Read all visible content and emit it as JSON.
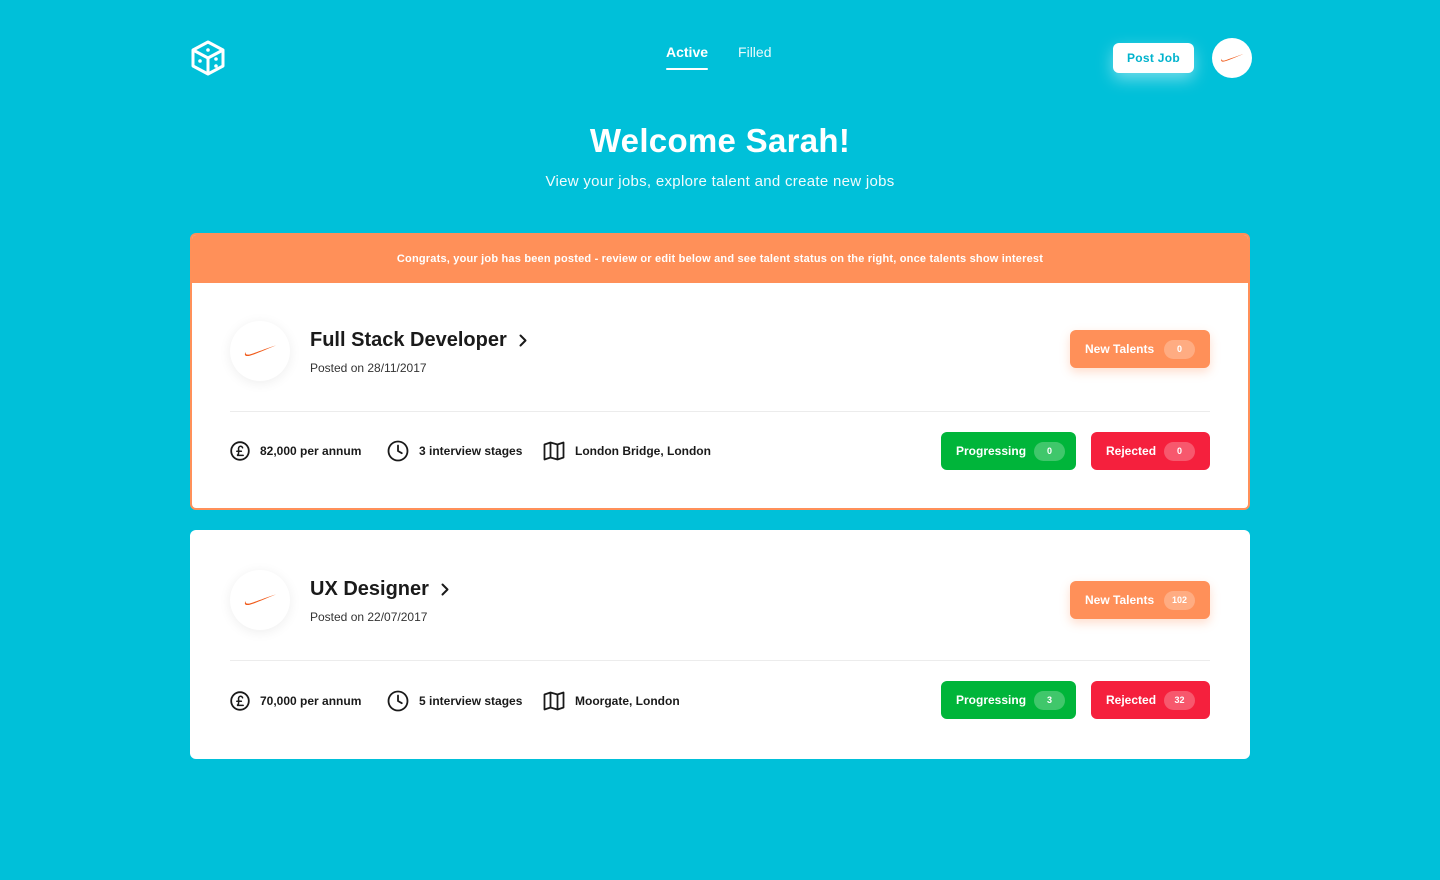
{
  "nav": {
    "tabs": [
      {
        "label": "Active",
        "active": true
      },
      {
        "label": "Filled",
        "active": false
      }
    ],
    "post_job_label": "Post Job"
  },
  "hero": {
    "title": "Welcome Sarah!",
    "subtitle": "View your jobs, explore talent and create new jobs"
  },
  "banner": {
    "message": "Congrats, your job has been posted - review or edit below and see talent status on the right, once talents show interest"
  },
  "jobs": [
    {
      "title": "Full Stack Developer",
      "posted": "Posted on 28/11/2017",
      "salary": "82,000 per annum",
      "stages": "3 interview stages",
      "location": "London Bridge, London",
      "new_talents_label": "New Talents",
      "new_talents_count": "0",
      "progressing_label": "Progressing",
      "progressing_count": "0",
      "rejected_label": "Rejected",
      "rejected_count": "0"
    },
    {
      "title": "UX Designer",
      "posted": "Posted on 22/07/2017",
      "salary": "70,000 per annum",
      "stages": "5 interview stages",
      "location": "Moorgate, London",
      "new_talents_label": "New Talents",
      "new_talents_count": "102",
      "progressing_label": "Progressing",
      "progressing_count": "3",
      "rejected_label": "Rejected",
      "rejected_count": "32"
    }
  ],
  "colors": {
    "background": "#00c0d9",
    "accent_orange": "#ff9059",
    "progress_green": "#00b53a",
    "reject_red": "#f5203d",
    "brand_logo": "#f05a1a"
  },
  "icons": {
    "logo": "cube-icon",
    "company": "swoosh-icon",
    "salary": "pound-icon",
    "stages": "clock-icon",
    "location": "map-icon",
    "title_arrow": "chevron-right-icon"
  }
}
